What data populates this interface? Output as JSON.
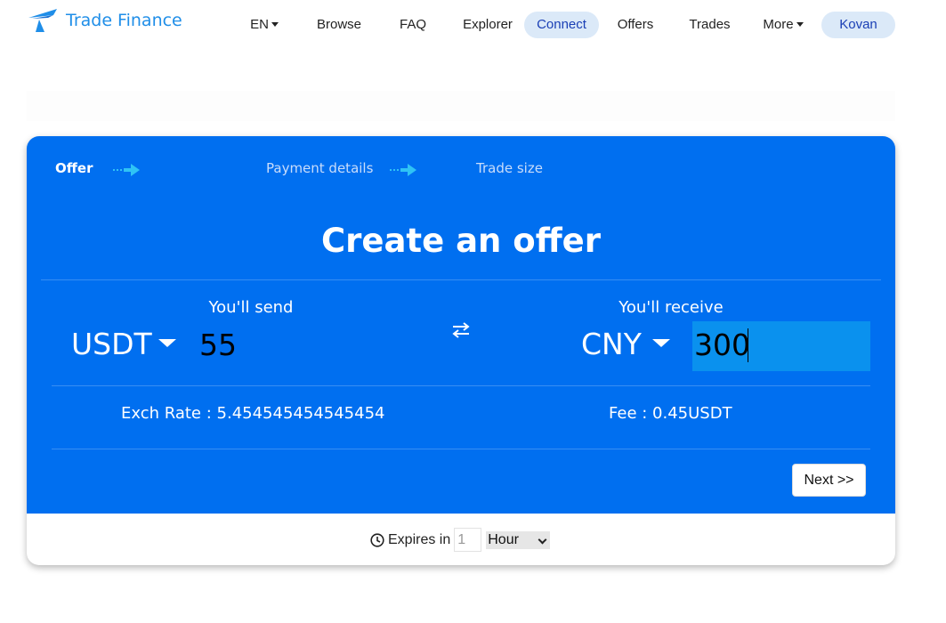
{
  "nav": {
    "brand": "Trade Finance",
    "language": "EN",
    "items": [
      "Browse",
      "FAQ",
      "Explorer",
      "Connect",
      "Offers",
      "Trades",
      "More"
    ],
    "network": "Kovan"
  },
  "steps": [
    "Offer",
    "Payment details",
    "Trade size"
  ],
  "offer": {
    "title": "Create an offer",
    "send_label": "You'll send",
    "send_currency": "USDT",
    "send_amount": "55",
    "receive_label": "You'll receive",
    "receive_currency": "CNY",
    "receive_amount": "300",
    "rate_label": "Exch Rate :",
    "rate_value": "5.454545454545454",
    "fee_label": "Fee :",
    "fee_value": "0.45USDT",
    "next_label": "Next >>"
  },
  "expiry": {
    "label": "Expires in",
    "value": "1",
    "unit": "Hour"
  },
  "colors": {
    "primary": "#006ff0",
    "brand": "#1f8ee8",
    "pill": "#dbe9f8",
    "arrow": "#2fc3f5"
  }
}
